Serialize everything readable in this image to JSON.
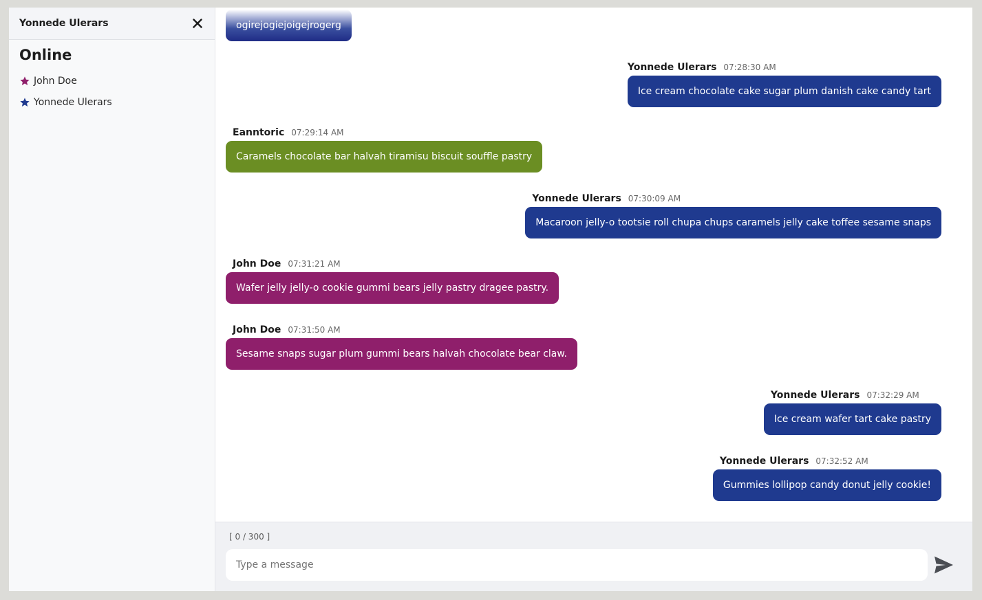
{
  "sidebar": {
    "title": "Yonnede Ulerars",
    "online_heading": "Online",
    "users": [
      {
        "name": "John Doe",
        "star_color": "#8f1f6b"
      },
      {
        "name": "Yonnede Ulerars",
        "star_color": "#1f3a8f"
      }
    ]
  },
  "messages": [
    {
      "author": "",
      "time": "",
      "text": "ogirejogiejoigejrogerg",
      "side": "left",
      "style": "faded"
    },
    {
      "author": "Yonnede Ulerars",
      "time": "07:28:30 AM",
      "text": "Ice cream chocolate cake sugar plum danish cake candy tart",
      "side": "right",
      "style": "self"
    },
    {
      "author": "Eanntoric",
      "time": "07:29:14 AM",
      "text": "Caramels chocolate bar halvah tiramisu biscuit souffle pastry",
      "side": "left",
      "style": "green"
    },
    {
      "author": "Yonnede Ulerars",
      "time": "07:30:09 AM",
      "text": "Macaroon jelly-o tootsie roll chupa chups caramels jelly cake toffee sesame snaps",
      "side": "right",
      "style": "self"
    },
    {
      "author": "John Doe",
      "time": "07:31:21 AM",
      "text": "Wafer jelly jelly-o cookie gummi bears jelly pastry dragee pastry.",
      "side": "left",
      "style": "pink"
    },
    {
      "author": "John Doe",
      "time": "07:31:50 AM",
      "text": "Sesame snaps sugar plum gummi bears halvah chocolate bear claw.",
      "side": "left",
      "style": "pink"
    },
    {
      "author": "Yonnede Ulerars",
      "time": "07:32:29 AM",
      "text": "Ice cream wafer tart cake pastry",
      "side": "right",
      "style": "self"
    },
    {
      "author": "Yonnede Ulerars",
      "time": "07:32:52 AM",
      "text": "Gummies lollipop candy donut jelly cookie!",
      "side": "right",
      "style": "self"
    }
  ],
  "composer": {
    "counter": "[ 0 / 300 ]",
    "placeholder": "Type a message",
    "value": ""
  },
  "colors": {
    "self_bubble": "#1f3a8f",
    "green_bubble": "#6b8e23",
    "pink_bubble": "#8f1f6b"
  }
}
